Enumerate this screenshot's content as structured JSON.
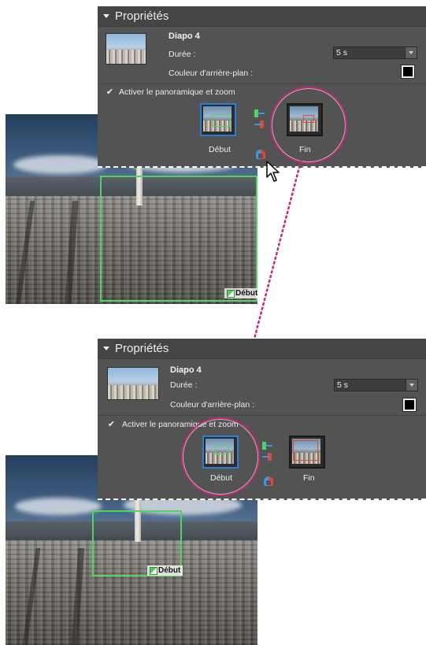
{
  "panels": [
    {
      "title": "Propriétés",
      "slide_name": "Diapo 4",
      "duration_label": "Durée :",
      "duration_value": "5 s",
      "bg_color_label": "Couleur d'arrière-plan :",
      "bg_color": "#000000",
      "pan_zoom_label": "Activer le panoramique et zoom",
      "pan_zoom_enabled": true,
      "start_label": "Début",
      "end_label": "Fin",
      "selected": "end"
    },
    {
      "title": "Propriétés",
      "slide_name": "Diapo 4",
      "duration_label": "Durée :",
      "duration_value": "5 s",
      "bg_color_label": "Couleur d'arrière-plan :",
      "bg_color": "#000000",
      "pan_zoom_label": "Activer le panoramique et zoom",
      "pan_zoom_enabled": true,
      "start_label": "Début",
      "end_label": "Fin",
      "selected": "start"
    }
  ],
  "photo_tags": {
    "top": "Début",
    "bottom": "Début"
  },
  "colors": {
    "panel_bg": "#535353",
    "highlight_circle": "#c02a78",
    "start_frame": "#4fd462",
    "end_frame": "#e0483c",
    "selected_border": "#2b7fd6"
  },
  "icons": [
    "collapse-arrow-icon",
    "checkbox-icon",
    "swap-icon",
    "copy-icon",
    "mouse-pointer-icon"
  ]
}
